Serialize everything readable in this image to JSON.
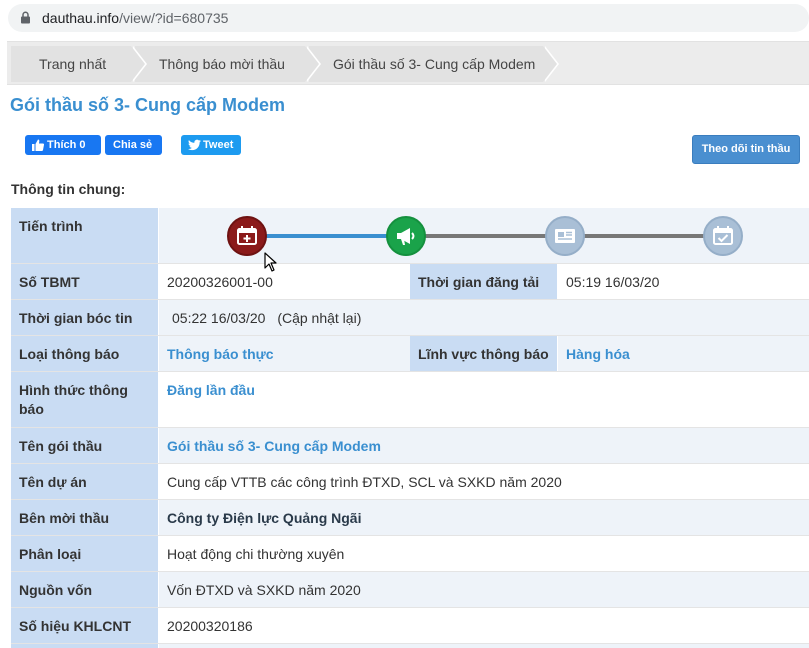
{
  "browser": {
    "url_domain": "dauthau.info",
    "url_path": "/view/?id=680735"
  },
  "breadcrumb": [
    "Trang nhất",
    "Thông báo mời thầu",
    "Gói thầu số 3- Cung cấp Modem"
  ],
  "page_title": "Gói thầu số 3- Cung cấp Modem",
  "social": {
    "like_label": "Thích 0",
    "share_label": "Chia sẻ",
    "tweet_label": "Tweet"
  },
  "follow_button": "Theo dõi tin thầu",
  "section_title": "Thông tin chung:",
  "info": {
    "progress_label": "Tiến trình",
    "so_tbmt_label": "Số TBMT",
    "so_tbmt": "20200326001-00",
    "thoi_gian_dang_tai_label": "Thời gian đăng tải",
    "thoi_gian_dang_tai": "05:19 16/03/20",
    "thoi_gian_boc_tin_label": "Thời gian bóc tin",
    "thoi_gian_boc_tin": "05:22 16/03/20",
    "cap_nhat_lai": "(Cập nhật lại)",
    "loai_thong_bao_label": "Loại thông báo",
    "loai_thong_bao": "Thông báo thực",
    "linh_vuc_label": "Lĩnh vực thông báo",
    "linh_vuc": "Hàng hóa",
    "hinh_thuc_label_1": "Hình thức thông",
    "hinh_thuc_label_2": "báo",
    "hinh_thuc": "Đăng lần đầu",
    "ten_goi_thau_label": "Tên gói thầu",
    "ten_goi_thau": "Gói thầu số 3- Cung cấp Modem",
    "ten_du_an_label": "Tên dự án",
    "ten_du_an": "Cung cấp VTTB các công trình ĐTXD, SCL và SXKD năm 2020",
    "ben_moi_thau_label": "Bên mời thầu",
    "ben_moi_thau": "Công ty Điện lực Quảng Ngãi",
    "phan_loai_label": "Phân loại",
    "phan_loai": "Hoạt động chi thường xuyên",
    "nguon_von_label": "Nguồn vốn",
    "nguon_von": "Vốn ĐTXD và SXKD năm 2020",
    "so_hieu_label": "Số hiệu KHLCNT",
    "so_hieu": "20200320186"
  },
  "timeline_icons": [
    "calendar-plus-icon",
    "megaphone-icon",
    "newspaper-icon",
    "calendar-check-icon"
  ],
  "colors": {
    "accent": "#3a8fd0",
    "label_bg": "#c9dcf3",
    "value_bg": "#eef3f9",
    "node1": "#8b1a1a",
    "node2": "#1aa34a",
    "node_inactive": "#a9bfd6"
  }
}
